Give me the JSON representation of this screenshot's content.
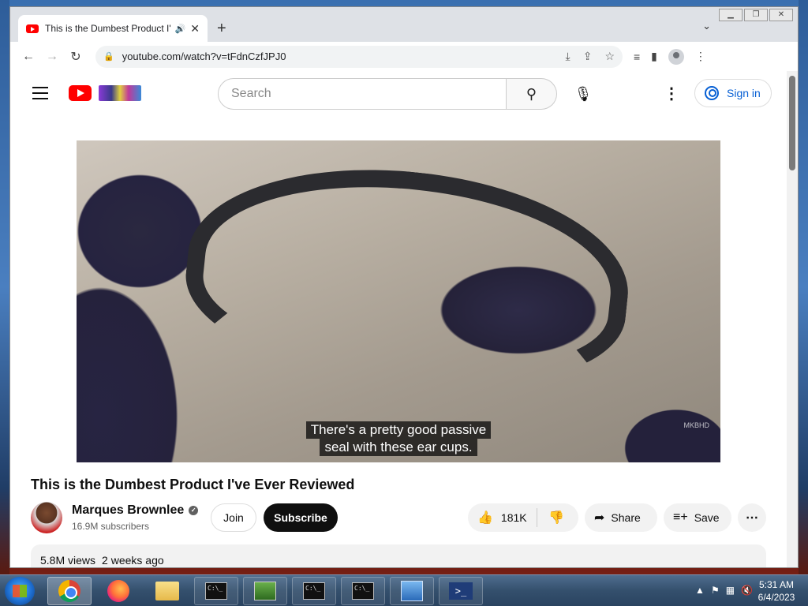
{
  "browser": {
    "tab_title": "This is the Dumbest Product I've Ever Reviewed",
    "url": "youtube.com/watch?v=tFdnCzfJPJ0",
    "new_tab_symbol": "+",
    "tab_close_symbol": "✕"
  },
  "youtube": {
    "search_placeholder": "Search",
    "sign_in_label": "Sign in",
    "video": {
      "caption_line1": "There's a pretty good passive",
      "caption_line2": "seal with these ear cups.",
      "watermark": "MKBHD",
      "title": "This is the Dumbest Product I've Ever Reviewed",
      "channel_name": "Marques Brownlee",
      "subscribers": "16.9M subscribers",
      "join_label": "Join",
      "subscribe_label": "Subscribe",
      "likes": "181K",
      "share_label": "Share",
      "save_label": "Save",
      "views": "5.8M views",
      "uploaded": "2 weeks ago"
    }
  },
  "taskbar": {
    "time": "5:31 AM",
    "date": "6/4/2023",
    "cmd_label": "C:\\_"
  },
  "icons": [
    "youtube-favicon",
    "audio-icon",
    "close-icon",
    "back-icon",
    "forward-icon",
    "reload-icon",
    "lock-icon",
    "install-icon",
    "share-icon",
    "star-icon",
    "media-icon",
    "sidepanel-icon",
    "profile-icon",
    "kebab-icon",
    "hamburger-icon",
    "search-icon",
    "mic-icon",
    "user-icon",
    "verified-icon",
    "like-icon",
    "dislike-icon",
    "save-icon",
    "more-icon",
    "start-orb-icon",
    "chrome-icon",
    "firefox-icon",
    "folder-icon",
    "cmd-icon",
    "powershell-icon"
  ]
}
